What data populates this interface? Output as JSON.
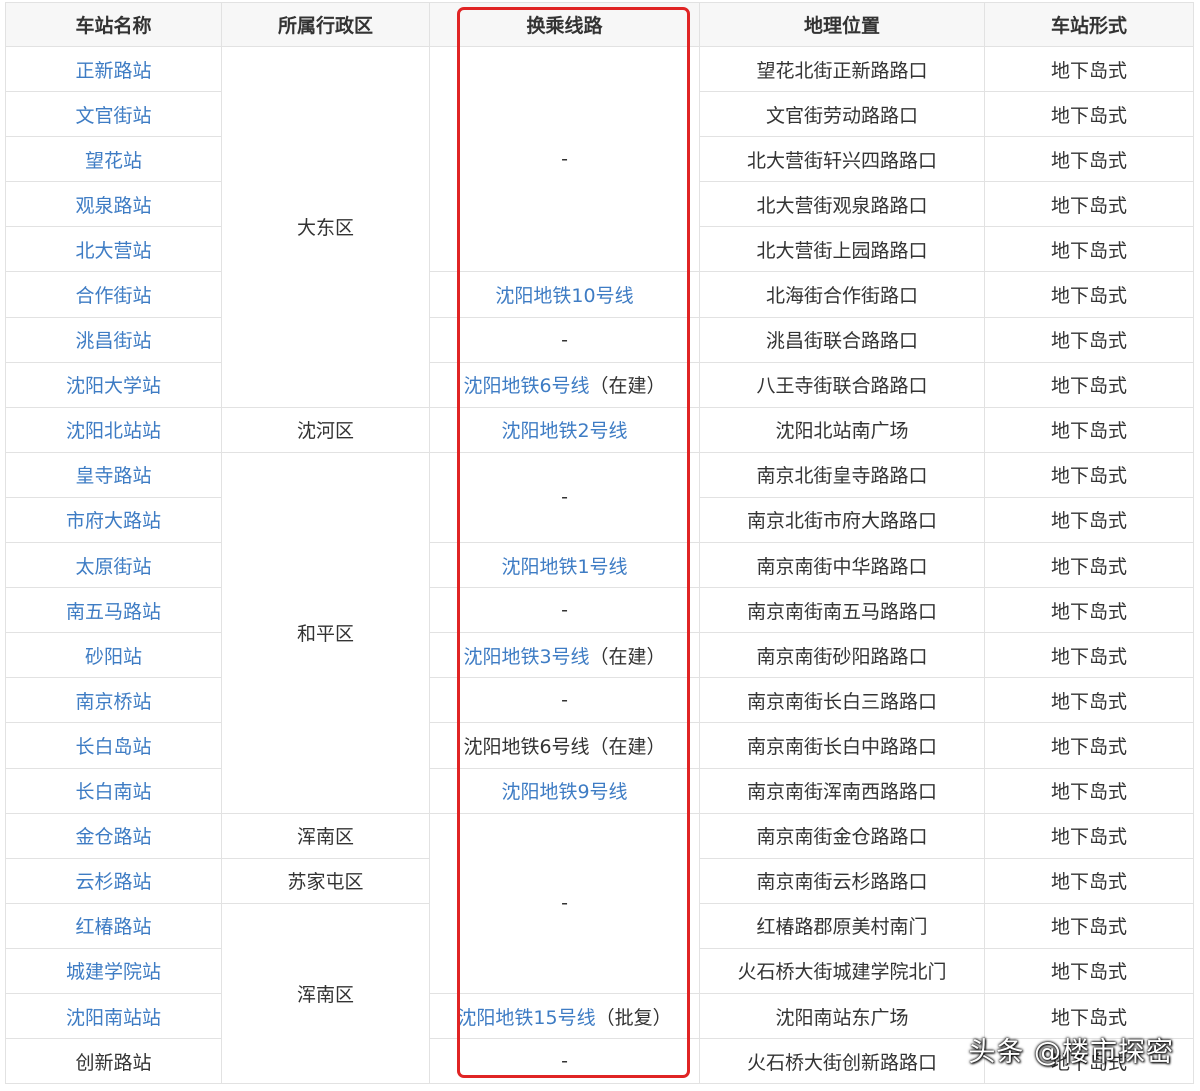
{
  "headers": [
    "车站名称",
    "所属行政区",
    "换乘线路",
    "地理位置",
    "车站形式"
  ],
  "rows": [
    {
      "name": "正新路站",
      "location": "望花北街正新路路口",
      "form": "地下岛式"
    },
    {
      "name": "文官街站",
      "location": "文官街劳动路路口",
      "form": "地下岛式"
    },
    {
      "name": "望花站",
      "location": "北大营街轩兴四路路口",
      "form": "地下岛式"
    },
    {
      "name": "观泉路站",
      "location": "北大营街观泉路路口",
      "form": "地下岛式"
    },
    {
      "name": "北大营站",
      "location": "北大营街上园路路口",
      "form": "地下岛式"
    },
    {
      "name": "合作街站",
      "location": "北海街合作街路口",
      "form": "地下岛式"
    },
    {
      "name": "洮昌街站",
      "location": "洮昌街联合路路口",
      "form": "地下岛式"
    },
    {
      "name": "沈阳大学站",
      "location": "八王寺街联合路路口",
      "form": "地下岛式"
    },
    {
      "name": "沈阳北站站",
      "location": "沈阳北站南广场",
      "form": "地下岛式"
    },
    {
      "name": "皇寺路站",
      "location": "南京北街皇寺路路口",
      "form": "地下岛式"
    },
    {
      "name": "市府大路站",
      "location": "南京北街市府大路路口",
      "form": "地下岛式"
    },
    {
      "name": "太原街站",
      "location": "南京南街中华路路口",
      "form": "地下岛式"
    },
    {
      "name": "南五马路站",
      "location": "南京南街南五马路路口",
      "form": "地下岛式"
    },
    {
      "name": "砂阳站",
      "location": "南京南街砂阳路路口",
      "form": "地下岛式"
    },
    {
      "name": "南京桥站",
      "location": "南京南街长白三路路口",
      "form": "地下岛式"
    },
    {
      "name": "长白岛站",
      "location": "南京南街长白中路路口",
      "form": "地下岛式"
    },
    {
      "name": "长白南站",
      "location": "南京南街浑南西路路口",
      "form": "地下岛式"
    },
    {
      "name": "金仓路站",
      "location": "南京南街金仓路路口",
      "form": "地下岛式"
    },
    {
      "name": "云杉路站",
      "location": "南京南街云杉路路口",
      "form": "地下岛式"
    },
    {
      "name": "红椿路站",
      "location": "红椿路郡原美村南门",
      "form": "地下岛式"
    },
    {
      "name": "城建学院站",
      "location": "火石桥大街城建学院北门",
      "form": "地下岛式"
    },
    {
      "name": "沈阳南站站",
      "location": "沈阳南站东广场",
      "form": "地下岛式"
    },
    {
      "name": "创新路站",
      "location": "火石桥大街创新路路口",
      "form": "地下岛式"
    }
  ],
  "districts": {
    "dadong": "大东区",
    "shenhe": "沈河区",
    "heping": "和平区",
    "hunnan1": "浑南区",
    "sujiatun": "苏家屯区",
    "hunnan2": "浑南区"
  },
  "transfers": {
    "t1": "-",
    "t2": "沈阳地铁10号线",
    "t3": "-",
    "t4_line": "沈阳地铁6号线",
    "t4_note": "（在建）",
    "t5": "沈阳地铁2号线",
    "t6": "-",
    "t7": "沈阳地铁1号线",
    "t8": "-",
    "t9_line": "沈阳地铁3号线",
    "t9_note": "（在建）",
    "t10": "-",
    "t11": "沈阳地铁6号线（在建）",
    "t12": "沈阳地铁9号线",
    "t13": "-",
    "t14_line": "沈阳地铁15号线",
    "t14_note": "（批复）",
    "t15": "-"
  },
  "colors": {
    "link": "#3e7cc4",
    "highlight_frame": "#e02424"
  },
  "watermark": "头条 @楼市探密"
}
